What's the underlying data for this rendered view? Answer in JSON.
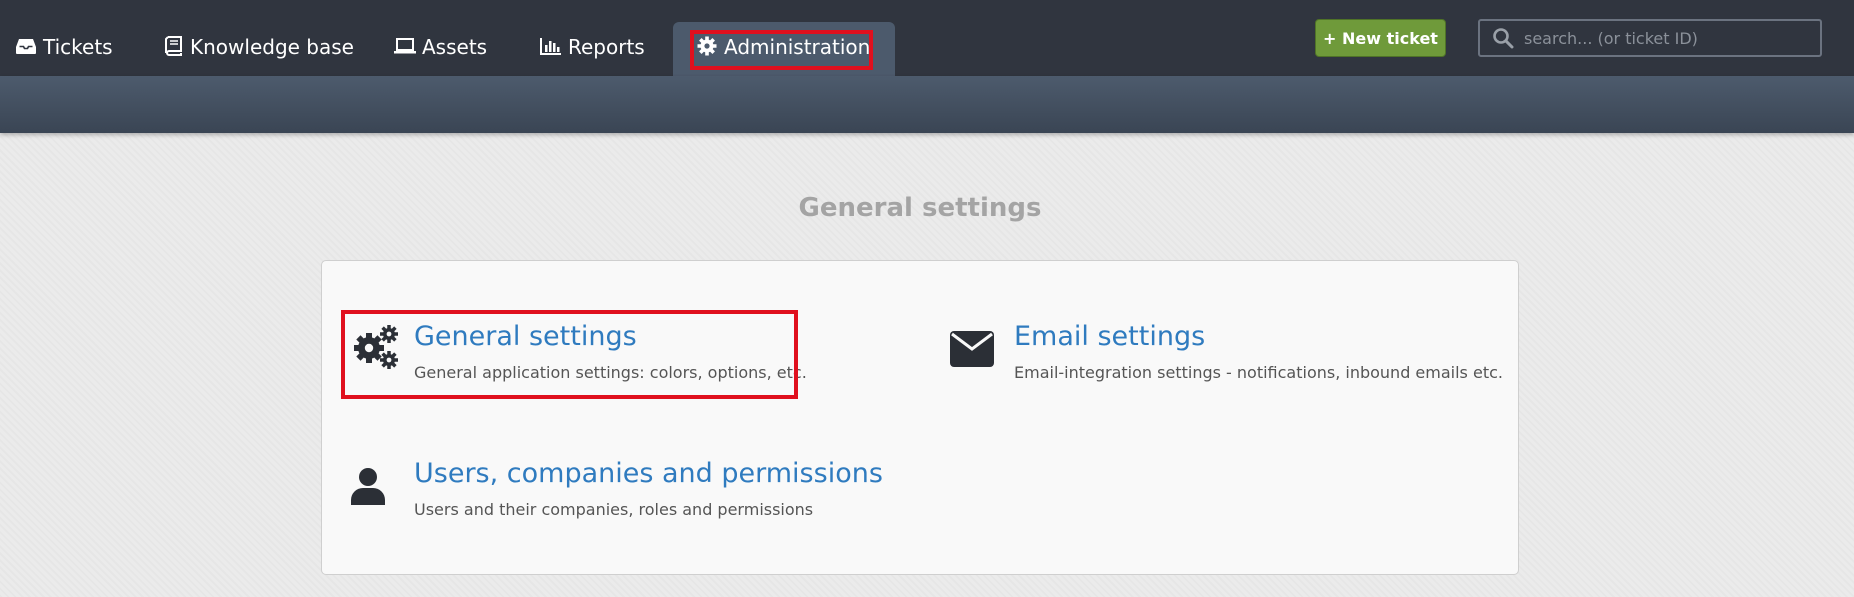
{
  "nav": {
    "tabs": [
      {
        "label": "Tickets",
        "icon": "inbox-icon"
      },
      {
        "label": "Knowledge base",
        "icon": "book-icon"
      },
      {
        "label": "Assets",
        "icon": "laptop-icon"
      },
      {
        "label": "Reports",
        "icon": "bar-chart-icon"
      },
      {
        "label": "Administration",
        "icon": "gear-icon",
        "active": true
      }
    ],
    "new_ticket_label": "+ New ticket",
    "search_placeholder": "search... (or ticket ID)"
  },
  "main": {
    "section_title": "General settings",
    "items": [
      {
        "title": "General settings",
        "description": "General application settings: colors, options, etc.",
        "icon": "gears-icon"
      },
      {
        "title": "Email settings",
        "description": "Email-integration settings - notifications, inbound emails etc.",
        "icon": "envelope-icon"
      },
      {
        "title": "Users, companies and permissions",
        "description": "Users and their companies, roles and permissions",
        "icon": "user-icon"
      }
    ]
  },
  "colors": {
    "topbar": "#30353f",
    "active_tab": "#4c5a6c",
    "link": "#2f7bbf",
    "new_ticket_button": "#6f9a3a",
    "highlight": "#e0101e"
  }
}
